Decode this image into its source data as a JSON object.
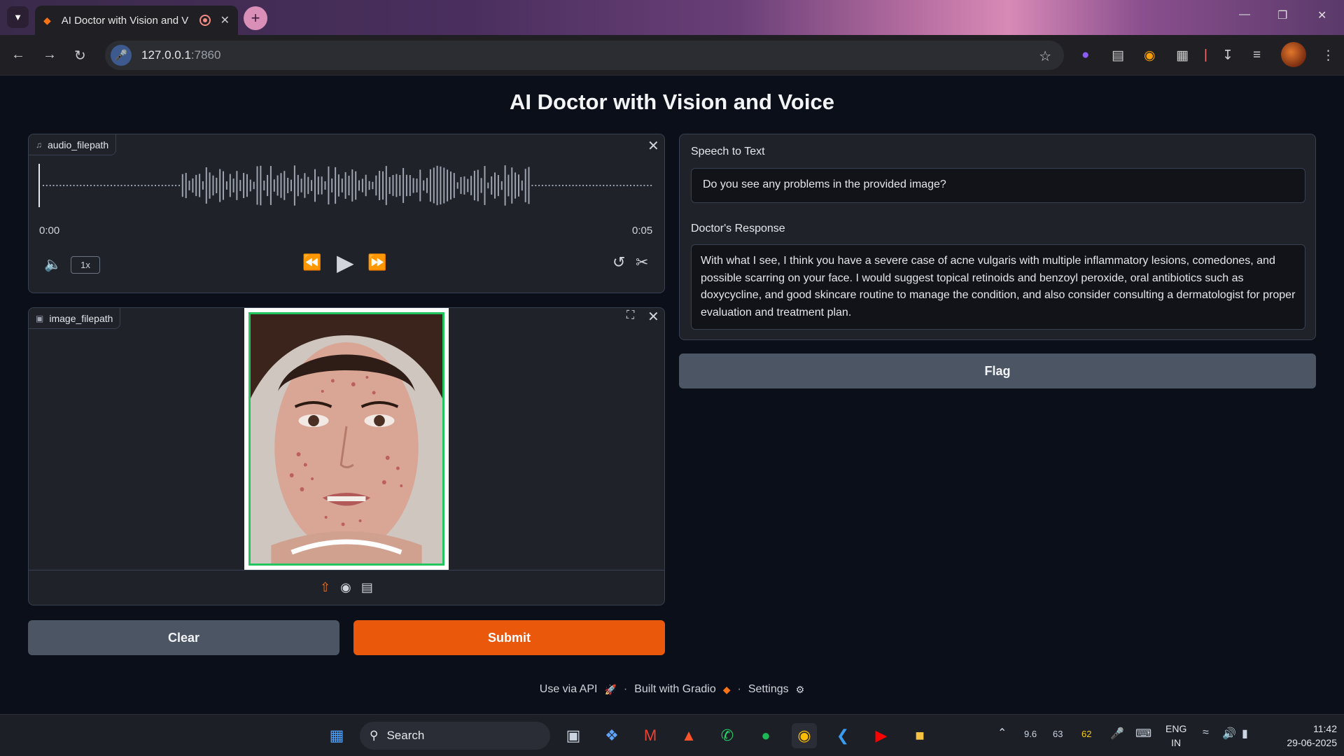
{
  "browser": {
    "tab_title": "AI Doctor with Vision and V",
    "url_host": "127.0.0.1",
    "url_port": ":7860"
  },
  "app": {
    "title": "AI Doctor with Vision and Voice"
  },
  "audio": {
    "label": "audio_filepath",
    "time_current": "0:00",
    "time_total": "0:05",
    "speed": "1x"
  },
  "image": {
    "label": "image_filepath"
  },
  "buttons": {
    "clear": "Clear",
    "submit": "Submit",
    "flag": "Flag"
  },
  "outputs": {
    "stt_label": "Speech to Text",
    "stt_value": "Do you see any problems in the provided image?",
    "response_label": "Doctor's Response",
    "response_value": "With what I see, I think you have a severe case of acne vulgaris with multiple inflammatory lesions, comedones, and possible scarring on your face. I would suggest topical retinoids and benzoyl peroxide, oral antibiotics such as doxycycline, and good skincare routine to manage the condition, and also consider consulting a dermatologist for proper evaluation and treatment plan."
  },
  "footer": {
    "api": "Use via API",
    "built": "Built with Gradio",
    "settings": "Settings"
  },
  "taskbar": {
    "search": "Search",
    "tray_cpu": "9.6",
    "tray_a": "63",
    "tray_b": "62",
    "lang_1": "ENG",
    "lang_2": "IN",
    "time": "11:42",
    "date": "29-06-2025"
  },
  "colors": {
    "accent": "#ea580c",
    "secondary_button": "#4b5563",
    "background": "#0b0f19",
    "panel": "#1f2229"
  }
}
